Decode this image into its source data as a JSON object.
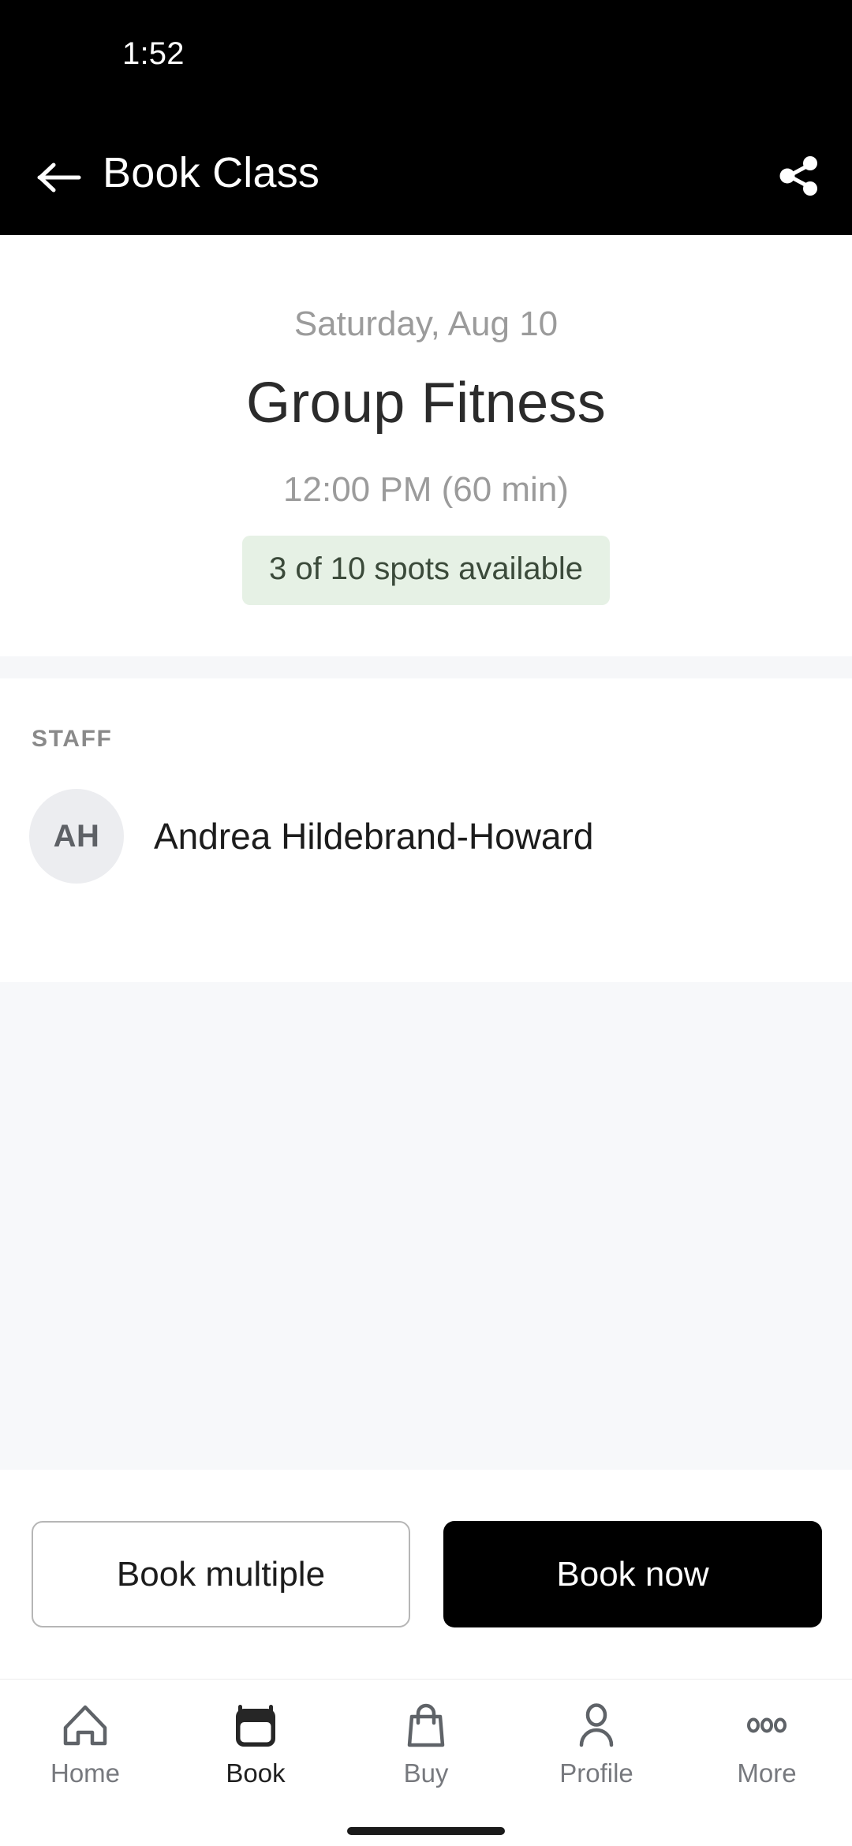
{
  "status_bar": {
    "time": "1:52"
  },
  "app_bar": {
    "title": "Book Class",
    "back_icon": "arrow-left-icon",
    "share_icon": "share-icon"
  },
  "class_info": {
    "date": "Saturday, Aug 10",
    "name": "Group Fitness",
    "time": "12:00 PM (60 min)",
    "availability": "3 of 10 spots available",
    "availability_bg": "#e6f1e5",
    "availability_fg": "#3b4a3a"
  },
  "staff": {
    "section_label": "STAFF",
    "members": [
      {
        "initials": "AH",
        "name": "Andrea Hildebrand-Howard"
      }
    ]
  },
  "actions": {
    "secondary_label": "Book multiple",
    "primary_label": "Book now",
    "primary_bg": "#000000",
    "primary_fg": "#ffffff"
  },
  "bottom_nav": {
    "items": [
      {
        "label": "Home",
        "icon": "home-icon",
        "active": false
      },
      {
        "label": "Book",
        "icon": "calendar-icon",
        "active": true
      },
      {
        "label": "Buy",
        "icon": "shopping-bag-icon",
        "active": false
      },
      {
        "label": "Profile",
        "icon": "person-icon",
        "active": false
      },
      {
        "label": "More",
        "icon": "ellipsis-icon",
        "active": false
      }
    ]
  }
}
